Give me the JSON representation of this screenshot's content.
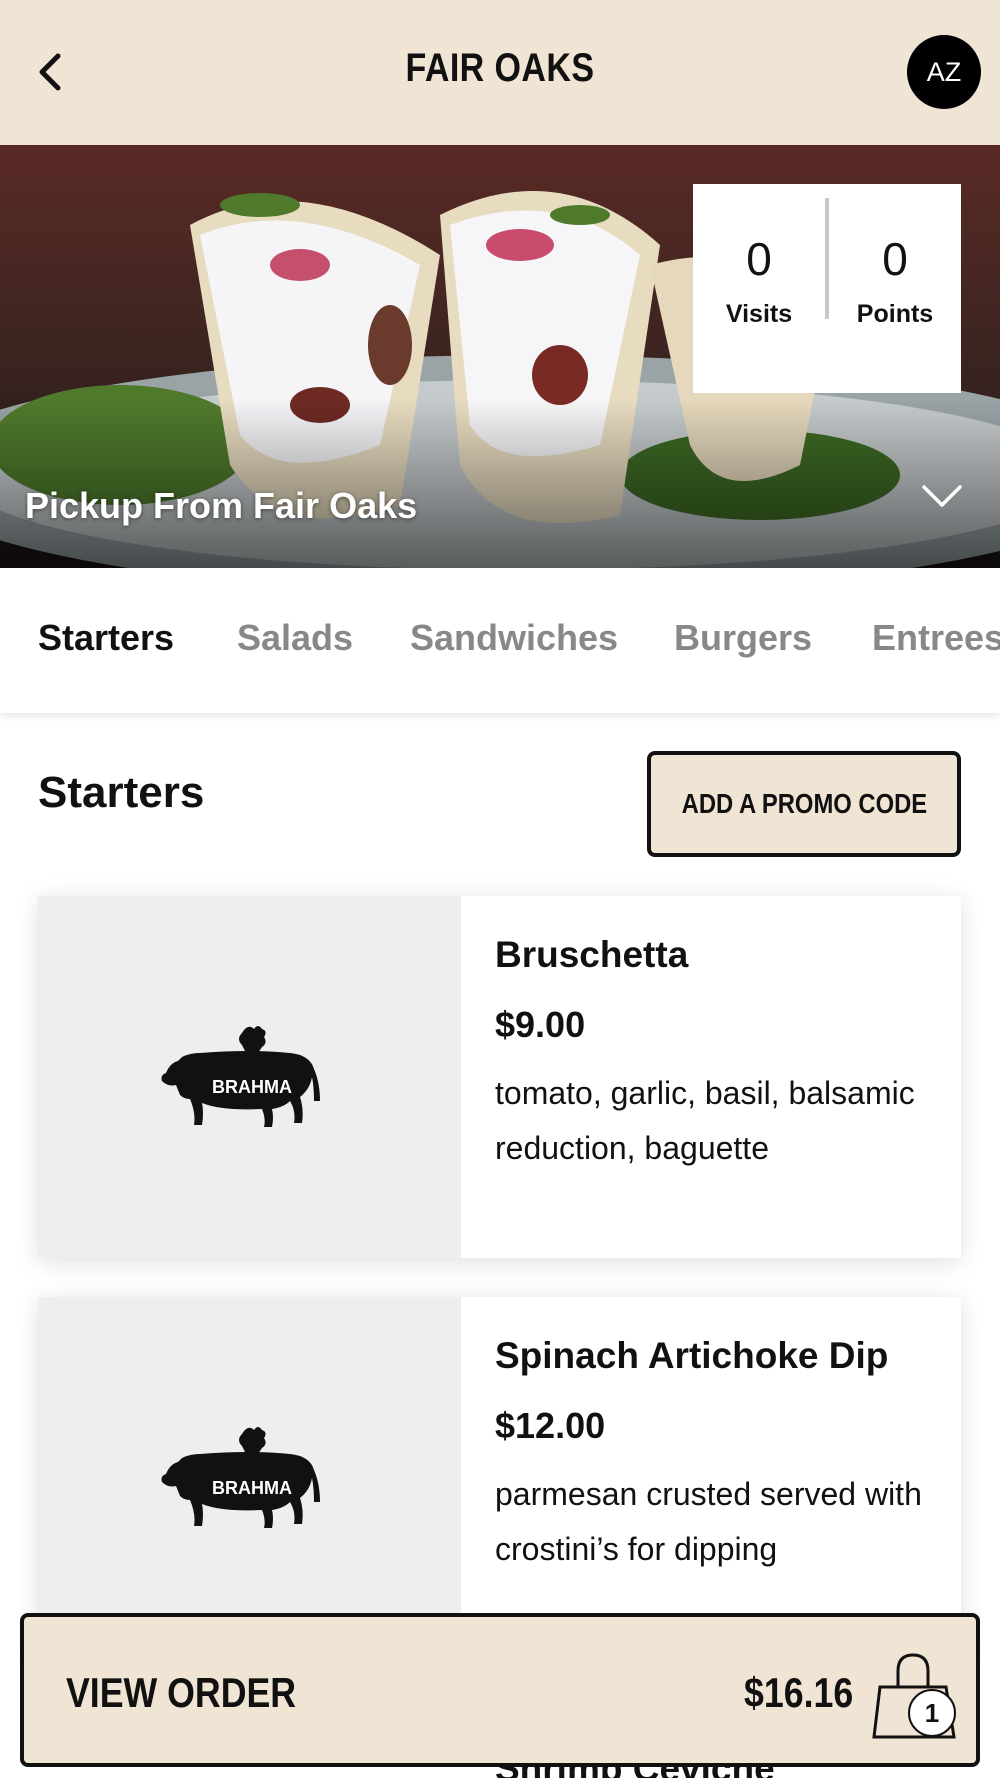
{
  "header": {
    "title": "FAIR OAKS",
    "avatar_initials": "AZ"
  },
  "hero": {
    "pickup_text": "Pickup From Fair Oaks",
    "stats": {
      "visits_value": "0",
      "visits_label": "Visits",
      "points_value": "0",
      "points_label": "Points"
    }
  },
  "tabs": [
    {
      "label": "Starters",
      "active": true
    },
    {
      "label": "Salads",
      "active": false
    },
    {
      "label": "Sandwiches",
      "active": false
    },
    {
      "label": "Burgers",
      "active": false
    },
    {
      "label": "Entrees",
      "active": false
    }
  ],
  "section": {
    "title": "Starters",
    "promo_label": "ADD A PROMO CODE"
  },
  "items": [
    {
      "name": "Bruschetta",
      "price": "$9.00",
      "description": "tomato, garlic, basil, balsamic reduction, baguette",
      "logo_text": "BRAHMA"
    },
    {
      "name": "Spinach Artichoke Dip",
      "price": "$12.00",
      "description": "parmesan crusted served with crostini’s for dipping",
      "logo_text": "BRAHMA"
    },
    {
      "name": "Shrimp Ceviche"
    }
  ],
  "order_bar": {
    "label": "VIEW ORDER",
    "total": "$16.16",
    "count": "1"
  },
  "icons": {
    "back": "chevron-left-icon",
    "expand": "chevron-down-icon",
    "bag": "shopping-bag-icon"
  }
}
